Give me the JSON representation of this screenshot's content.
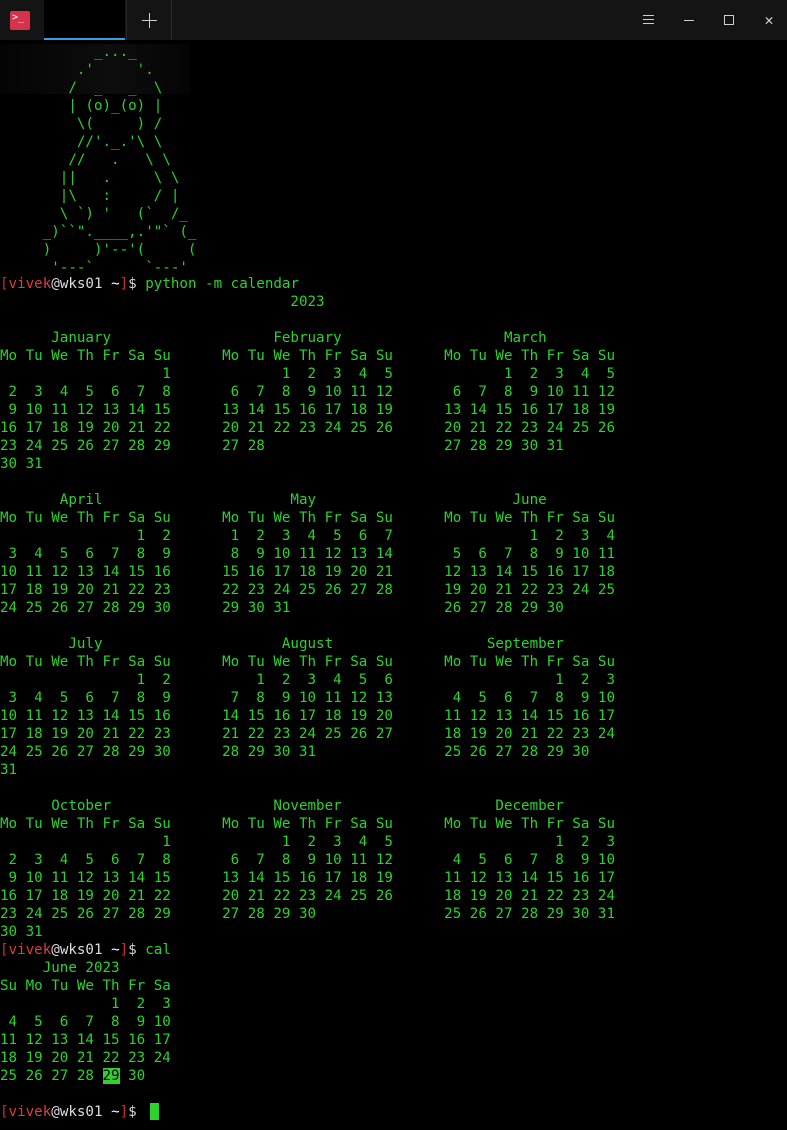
{
  "window": {
    "app_icon_text": ">_",
    "menu_icon": "hamburger-menu-icon",
    "minimize_icon": "minimize-icon",
    "maximize_icon": "maximize-icon",
    "close_icon": "close-icon",
    "new_tab_icon": "plus-icon"
  },
  "colors": {
    "background": "#000000",
    "output_green": "#2bd32b",
    "prompt_red": "#d4292e",
    "tab_accent": "#3d9be0",
    "app_icon": "#d8324a"
  },
  "ascii_art": [
    "           _..._",
    "         .'     '.",
    "        /  _   _  \\",
    "        | (o)_(o) |",
    "         \\(     ) /",
    "         //'._.'\\ \\",
    "        //   .   \\ \\",
    "       ||   .     \\ \\",
    "       |\\   :     / |",
    "       \\ `) '   (`  /_",
    "     _)``\".____,.'\"` (_",
    "     )     )'--'(     (",
    "      '---`      `---'"
  ],
  "prompt": {
    "open_bracket": "[",
    "user": "vivek",
    "at": "@",
    "host": "wks01",
    "path": " ~",
    "close_bracket": "]",
    "dollar": "$ "
  },
  "command1": "python -m calendar",
  "year_calendar": [
    "                                  2023",
    "",
    "      January                   February                   March",
    "Mo Tu We Th Fr Sa Su      Mo Tu We Th Fr Sa Su      Mo Tu We Th Fr Sa Su",
    "                   1             1  2  3  4  5             1  2  3  4  5",
    " 2  3  4  5  6  7  8       6  7  8  9 10 11 12       6  7  8  9 10 11 12",
    " 9 10 11 12 13 14 15      13 14 15 16 17 18 19      13 14 15 16 17 18 19",
    "16 17 18 19 20 21 22      20 21 22 23 24 25 26      20 21 22 23 24 25 26",
    "23 24 25 26 27 28 29      27 28                     27 28 29 30 31",
    "30 31",
    "",
    "       April                      May                       June",
    "Mo Tu We Th Fr Sa Su      Mo Tu We Th Fr Sa Su      Mo Tu We Th Fr Sa Su",
    "                1  2       1  2  3  4  5  6  7                1  2  3  4",
    " 3  4  5  6  7  8  9       8  9 10 11 12 13 14       5  6  7  8  9 10 11",
    "10 11 12 13 14 15 16      15 16 17 18 19 20 21      12 13 14 15 16 17 18",
    "17 18 19 20 21 22 23      22 23 24 25 26 27 28      19 20 21 22 23 24 25",
    "24 25 26 27 28 29 30      29 30 31                  26 27 28 29 30",
    "",
    "        July                     August                  September",
    "Mo Tu We Th Fr Sa Su      Mo Tu We Th Fr Sa Su      Mo Tu We Th Fr Sa Su",
    "                1  2          1  2  3  4  5  6                   1  2  3",
    " 3  4  5  6  7  8  9       7  8  9 10 11 12 13       4  5  6  7  8  9 10",
    "10 11 12 13 14 15 16      14 15 16 17 18 19 20      11 12 13 14 15 16 17",
    "17 18 19 20 21 22 23      21 22 23 24 25 26 27      18 19 20 21 22 23 24",
    "24 25 26 27 28 29 30      28 29 30 31               25 26 27 28 29 30",
    "31",
    "",
    "      October                   November                  December",
    "Mo Tu We Th Fr Sa Su      Mo Tu We Th Fr Sa Su      Mo Tu We Th Fr Sa Su",
    "                   1             1  2  3  4  5                   1  2  3",
    " 2  3  4  5  6  7  8       6  7  8  9 10 11 12       4  5  6  7  8  9 10",
    " 9 10 11 12 13 14 15      13 14 15 16 17 18 19      11 12 13 14 15 16 17",
    "16 17 18 19 20 21 22      20 21 22 23 24 25 26      18 19 20 21 22 23 24",
    "23 24 25 26 27 28 29      27 28 29 30               25 26 27 28 29 30 31",
    "30 31"
  ],
  "command2": "cal",
  "month_calendar": [
    "     June 2023",
    "Su Mo Tu We Th Fr Sa",
    "             1  2  3",
    " 4  5  6  7  8  9 10",
    "11 12 13 14 15 16 17",
    "18 19 20 21 22 23 24",
    "25 26 27 28 "
  ],
  "month_last_line_tail": " 30",
  "today": "29"
}
